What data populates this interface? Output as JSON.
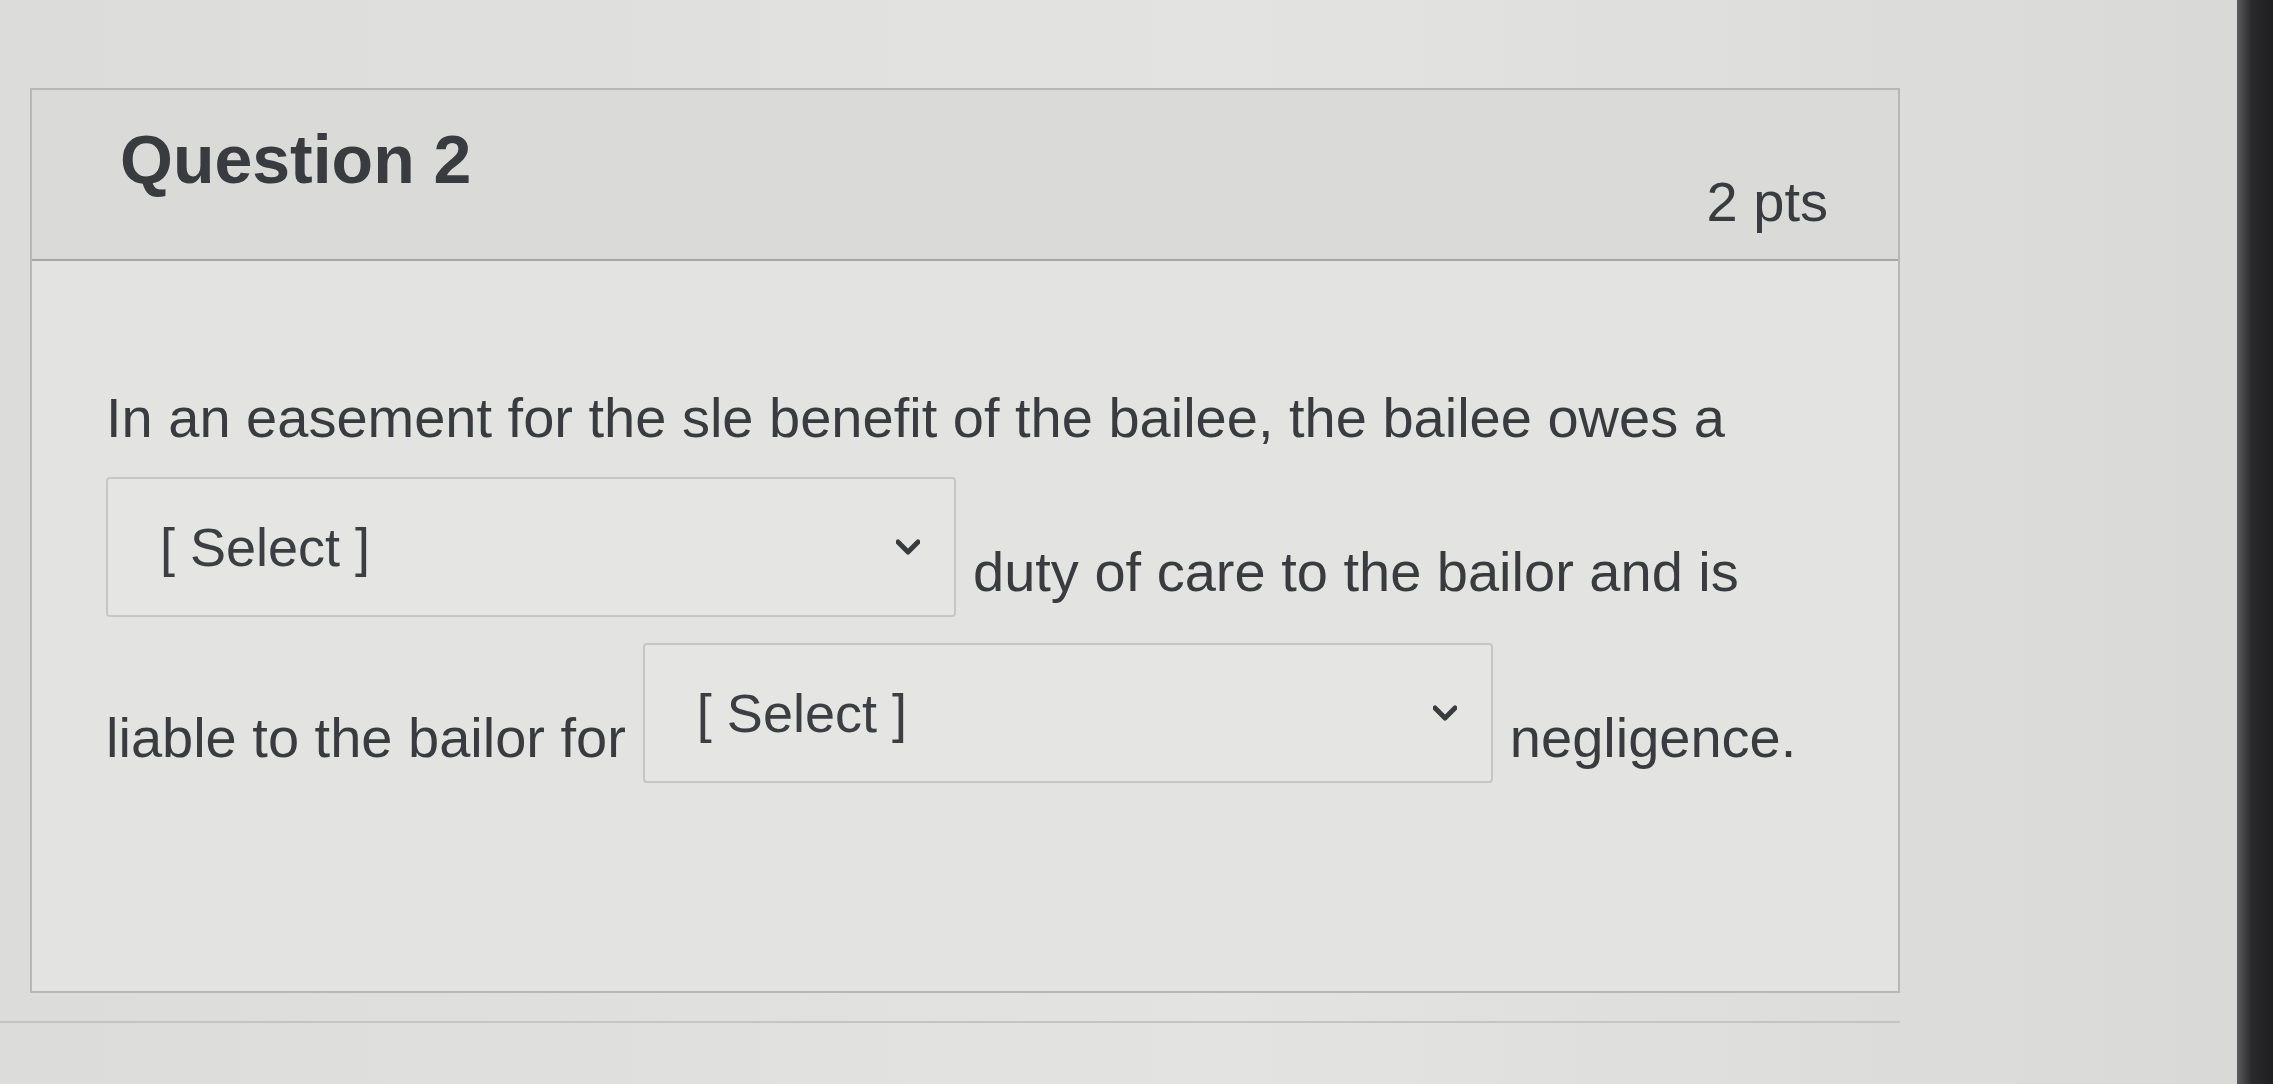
{
  "question": {
    "title": "Question 2",
    "points": "2 pts",
    "lines": [
      [
        {
          "kind": "text",
          "text": "In an easement for the sle benefit of the bailee, the bailee owes a"
        }
      ],
      [
        {
          "kind": "dropdown",
          "placeholder": "[ Select ]"
        },
        {
          "kind": "text",
          "text": "duty of care to the bailor and is"
        }
      ],
      [
        {
          "kind": "text",
          "text": "liable to the bailor for"
        },
        {
          "kind": "dropdown",
          "placeholder": "[ Select ]"
        },
        {
          "kind": "text",
          "text": "negligence."
        }
      ]
    ]
  }
}
